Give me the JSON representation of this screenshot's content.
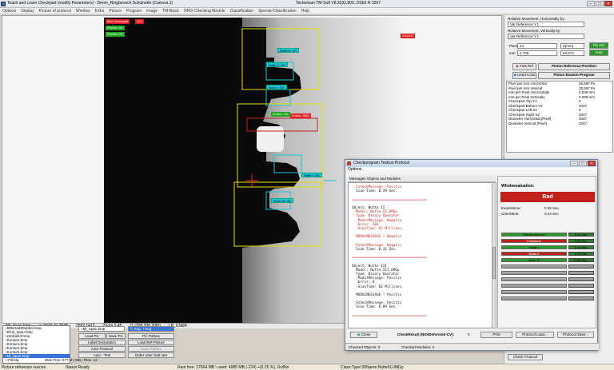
{
  "window": {
    "title": "Teach and Learn Checkpart (modify Parameters) - Demo_Ringbereich Schulnette (Camera 1)",
    "center": "Technikam TM-Soft",
    "right": "V8.2032.800, DSE2 R 3267"
  },
  "menu": [
    "Options",
    "Display",
    "Picture of protocol",
    "Window",
    "Extra",
    "Picture",
    "Program",
    "Image",
    "TM-Basic",
    "RRG-Checking Module",
    "Classification",
    "Special-Classification",
    "Help"
  ],
  "overlay": {
    "top_left_red": "Bad Checkpart",
    "top_left_red2": "CCI",
    "top_left_green1": "Pixelm: OK",
    "top_left_green2": "Pixelm: OK",
    "top_right_red": "SC2047",
    "cyan1": "NutteIII: OK",
    "cyan2": "Nutte II: OK",
    "cyan3": "Nutte I: OK",
    "cyan4": "Nutte I: OK",
    "cyan5": "Nutte III: OK",
    "green_bar": "Kontur: OK",
    "red_bar": "Kontur: BAD"
  },
  "image_status": {
    "file": "~Mi_Span.bmp",
    "coords": "x: 2044, Y: 2048",
    "size": "2592 1412",
    "zoom": "Zoom 0.45",
    "rgb": "(1 (208,208,208))",
    "mode": "LB_USER"
  },
  "file_list": [
    "~9952rad3Dubbel.bmp",
    "~Rmk_Span.bmp",
    "~zentrale3.bmp",
    "~Kontur2.bmp",
    "~Kontur1.bmp",
    "~Kontur0.bmp",
    "~Kontur5.bmp",
    "~Mi_Span.bmp",
    "~-Fill.btq"
  ],
  "file_list_selected": 7,
  "file_info": {
    "disk": "Disk-Free: 577 M | MB | Files: 12"
  },
  "controls": {
    "file_input": "~Mi_Span.bmp",
    "combo": "?, Img, ? Img",
    "load_pic": "Load Pic",
    "save_pic": "Save Pic",
    "pic_pathes": "Pic-Pathes",
    "label_declaration": "Label Declaration",
    "load_ref_picture": "Load Ref-Picture",
    "auto_protocol": "Auto-Protocol",
    "save_pathes": "Save Pathes",
    "auto_test": "Auto - Test",
    "order_user_sub_rare": "Order User Sub rare"
  },
  "status": {
    "left": "Picture reference succes",
    "status": "Status:Ready",
    "ram": "Ram free: 27664 MB \\ used: 4985 MB (-224) +(6.25 %), GrdNo",
    "class": "Class:Type:39",
    "name": "Name:NutteIII,UMGp"
  },
  "right_panel": {
    "pos_h_label": "Relative Movement, Horizontally by:",
    "pos_h_value": "Var Reference Y.1",
    "pos_v_label": "Relative Movement, Vertically by:",
    "pos_v_value": "Var Reference Y.1",
    "pixel_label": "Pixel",
    "pixel_value": "44",
    "pixel_unit": "Z(mm)",
    "pix_button": "Pix Attr",
    "mm_label": "mm",
    "mm_value": "1.700",
    "mm_value2": "63.674",
    "mm_button": "Auto",
    "piston_ref": "Piston Reference-Position",
    "first_ref": "Fast Ref",
    "used_coords": "Used Coos",
    "piston_exam": "Piston Examin-Program",
    "check_protocol": "Check Protocol"
  },
  "properties": [
    [
      "Pixel per mm Horizontal",
      "25.587 Px"
    ],
    [
      "Pixel per mm Vertical",
      "25.587 Px"
    ],
    [
      "mm per Pixel Horizontally",
      "0.039 mm"
    ],
    [
      "mm per Pixel Vertically",
      "0.039 mm"
    ],
    [
      "Checkpart Top Y1",
      "0"
    ],
    [
      "Checkpart Bottom Y2",
      "2047"
    ],
    [
      "Checkpart Left X1",
      "0"
    ],
    [
      "Checkpart Right X2",
      "2047"
    ],
    [
      "Diameter Horizontal [Pixel]",
      "2047"
    ],
    [
      "Diameter Vertical [Pixel]",
      "2047"
    ]
  ],
  "protocol": {
    "title": "Checkprogram Testrun Protocol",
    "menu": "Options",
    "group": "Messages Objects and Modules",
    "log": [
      {
        "t": "  ScheckMessage: Positiv",
        "c": "red"
      },
      {
        "t": "  Scan-Time: 0.39 Sec.",
        "c": "blk"
      },
      {
        "t": "",
        "c": "blk"
      },
      {
        "t": "=========================================",
        "c": "sep"
      },
      {
        "t": "",
        "c": "blk"
      },
      {
        "t": "Object: Nutte II",
        "c": "blk"
      },
      {
        "t": "  Modul: Nutte_II,UMGp",
        "c": "red"
      },
      {
        "t": "  Type: Binary Operator",
        "c": "red"
      },
      {
        "t": "  :ModulMessage: Negativ",
        "c": "red"
      },
      {
        "t": "  :Error: 203",
        "c": "red"
      },
      {
        "t": "  :ScanTime: 62 Millisec.",
        "c": "red"
      },
      {
        "t": "",
        "c": "blk"
      },
      {
        "t": "  MODULMESSAGE ! Negativ",
        "c": "red"
      },
      {
        "t": "",
        "c": "blk"
      },
      {
        "t": "  ScheckMessage: Negativ",
        "c": "red"
      },
      {
        "t": "  Scan-Time: 0.11 Sec.",
        "c": "blk"
      },
      {
        "t": "",
        "c": "blk"
      },
      {
        "t": "=========================================",
        "c": "sep"
      },
      {
        "t": "",
        "c": "blk"
      },
      {
        "t": "Object: Nutte III",
        "c": "blk"
      },
      {
        "t": "  Modul: Nutte_III,UMGp",
        "c": "blk"
      },
      {
        "t": "  Type: Binary Operator",
        "c": "blk"
      },
      {
        "t": "  :ModulMessage: Positiv",
        "c": "blk"
      },
      {
        "t": "  :Error: 0",
        "c": "blk"
      },
      {
        "t": "  :ScanTime: 62 Millisec.",
        "c": "blk"
      },
      {
        "t": "",
        "c": "blk"
      },
      {
        "t": "  MODULMESSAGE ! Positiv",
        "c": "blk"
      },
      {
        "t": "",
        "c": "blk"
      },
      {
        "t": "  ScheckMessage: Positiv",
        "c": "blk"
      },
      {
        "t": "  Scan-Time: 0.09 Sec.",
        "c": "blk"
      },
      {
        "t": "",
        "c": "blk"
      },
      {
        "t": "=========================================",
        "c": "sep"
      }
    ],
    "eval_title": "Wholeevaluation:",
    "result": "Bad",
    "examtime_label": "Examintime:",
    "examtime": "0.39 Sec.",
    "checktime_label": "Checktime:",
    "checktime": "0.44 Sec.",
    "bars": [
      {
        "name": "Referenzierung",
        "state": "g",
        "time": "0.11 Sec."
      },
      {
        "name": "Impedanz",
        "state": "r",
        "time": "0.09 Sec."
      },
      {
        "name": "Nutte I",
        "state": "g",
        "time": "0.11 Sec."
      },
      {
        "name": "Nutte II",
        "state": "r",
        "time": "0.11 Sec."
      },
      {
        "name": "Nutte III",
        "state": "g",
        "time": "0.09 Sec."
      },
      {
        "name": "",
        "state": "e",
        "time": ""
      },
      {
        "name": "",
        "state": "e",
        "time": ""
      },
      {
        "name": "",
        "state": "e",
        "time": ""
      },
      {
        "name": "",
        "state": "e",
        "time": ""
      },
      {
        "name": "",
        "state": "e",
        "time": ""
      },
      {
        "name": "",
        "state": "e",
        "time": ""
      }
    ],
    "close": "Close",
    "checkresult": "CheckResult (NIO/Deformed-CV):",
    "checkresult_val": "0",
    "print": "Print",
    "protocol_load": "Protocol Load...",
    "protocol_save": "Protocol Save...",
    "checked_objects": "Checked Objects: 3",
    "checked_modules": "Checked Modules: 3"
  },
  "colors": {
    "bad": "#c0221b",
    "ok": "#2d9a2d",
    "cyan": "#18c6d8",
    "yellow": "#e8e000"
  }
}
